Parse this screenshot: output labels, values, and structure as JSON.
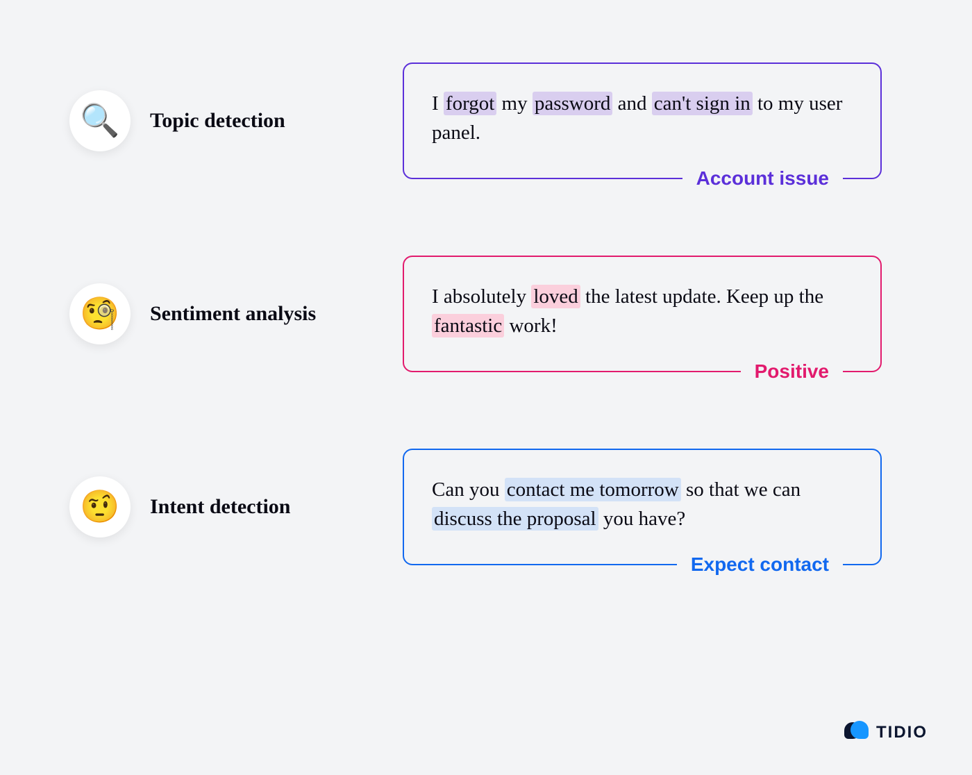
{
  "rows": [
    {
      "icon": "🔍",
      "label": "Topic detection",
      "color": "purple",
      "tag": "Account issue",
      "segments": [
        {
          "text": "I "
        },
        {
          "text": "forgot",
          "hl": true
        },
        {
          "text": " my "
        },
        {
          "text": "password",
          "hl": true
        },
        {
          "text": " and "
        },
        {
          "text": "can't sign in",
          "hl": true
        },
        {
          "text": " to my user panel."
        }
      ]
    },
    {
      "icon": "🧐",
      "label": "Sentiment analysis",
      "color": "pink",
      "tag": "Positive",
      "segments": [
        {
          "text": "I absolutely "
        },
        {
          "text": "loved",
          "hl": true
        },
        {
          "text": " the latest update. Keep up the "
        },
        {
          "text": "fantastic",
          "hl": true
        },
        {
          "text": " work!"
        }
      ]
    },
    {
      "icon": "🤨",
      "label": "Intent detection",
      "color": "blue",
      "tag": "Expect contact",
      "segments": [
        {
          "text": "Can you "
        },
        {
          "text": "contact me tomorrow",
          "hl": true
        },
        {
          "text": " so that we can "
        },
        {
          "text": "discuss the proposal",
          "hl": true
        },
        {
          "text": " you have?"
        }
      ]
    }
  ],
  "brand": "TIDIO"
}
